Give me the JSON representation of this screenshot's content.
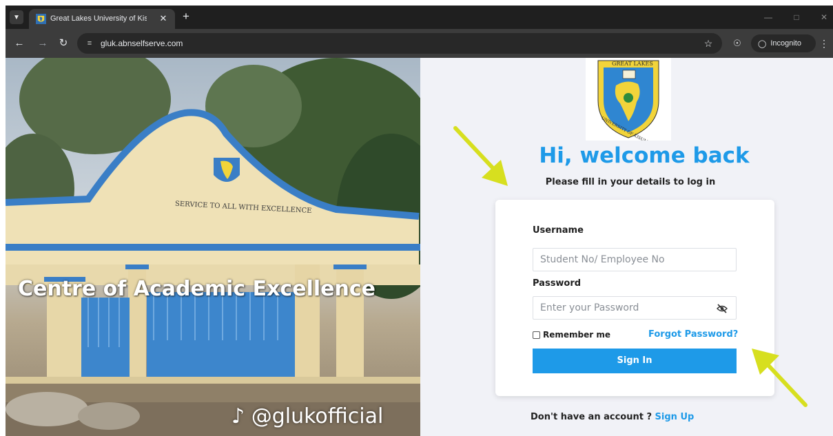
{
  "browser": {
    "tab_title": "Great Lakes University of Kisum",
    "url": "gluk.abnselfserve.com",
    "incognito_label": "Incognito",
    "icons": [
      "tab-list-icon",
      "favicon",
      "close-icon",
      "plus-icon",
      "minimize-icon",
      "restore-icon",
      "window-close-icon",
      "back-icon",
      "forward-icon",
      "reload-icon",
      "site-info-icon",
      "star-icon",
      "extension-icon",
      "incognito-icon",
      "kebab-menu-icon"
    ]
  },
  "hero": {
    "gate_sign": "SERVICE TO ALL WITH EXCELLENCE",
    "tagline": "Centre of Academic Excellence",
    "handle": "@glukofficial"
  },
  "logo": {
    "top_text": "GREAT LAKES",
    "bottom_text": "UNIVERSITY OF KISUMU"
  },
  "login": {
    "heading": "Hi, welcome back",
    "subtitle": "Please fill in your details to log in",
    "username_label": "Username",
    "username_placeholder": "Student No/ Employee No",
    "password_label": "Password",
    "password_placeholder": "Enter your Password",
    "remember_label": "Remember me",
    "forgot_label": "Forgot Password?",
    "signin_label": "Sign In",
    "signup_prompt": "Don't have an account ?",
    "signup_label": "Sign Up"
  },
  "colors": {
    "accent": "#1e9ae8",
    "annotation_arrow": "#d7df1f",
    "panel_bg": "#f1f2f7"
  }
}
